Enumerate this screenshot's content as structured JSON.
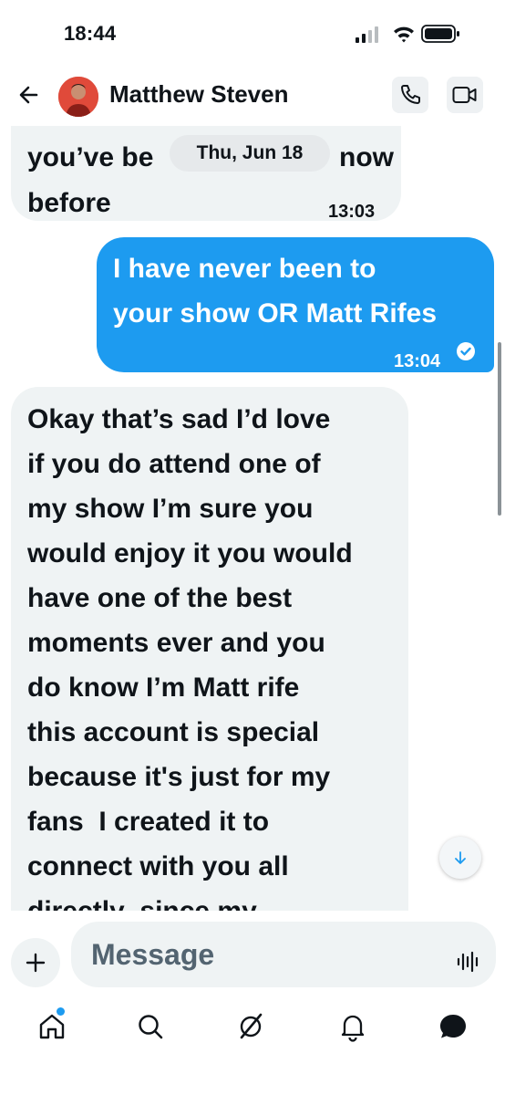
{
  "status_bar": {
    "time": "18:44"
  },
  "header": {
    "contact_name": "Matthew Steven"
  },
  "chat": {
    "date_divider": "Thu, Jun 18",
    "messages": [
      {
        "direction": "received",
        "lines": [
          "you’ve be",
          "now",
          "before"
        ],
        "time": "13:03"
      },
      {
        "direction": "sent",
        "lines": [
          "I have never been to",
          "your show OR Matt Rifes"
        ],
        "time": "13:04"
      },
      {
        "direction": "received",
        "lines": [
          "Okay that’s sad I’d love",
          "if you do attend one of",
          "my show I’m sure you",
          "would enjoy it you would",
          "have one of the best",
          "moments ever and you",
          "do know I’m Matt rife",
          "this account is special",
          "because it's just for my",
          "fans  I created it to",
          "connect with you all",
          "directly  since my"
        ]
      }
    ]
  },
  "composer": {
    "placeholder": "Message"
  },
  "colors": {
    "accent": "#1d9bf0",
    "received_bubble": "#eff3f4",
    "text": "#0f1419"
  },
  "icons": {
    "header": [
      "back-arrow-icon",
      "phone-icon",
      "video-icon"
    ],
    "nav": [
      "home-icon",
      "search-icon",
      "grok-icon",
      "bell-icon",
      "messages-icon"
    ]
  }
}
